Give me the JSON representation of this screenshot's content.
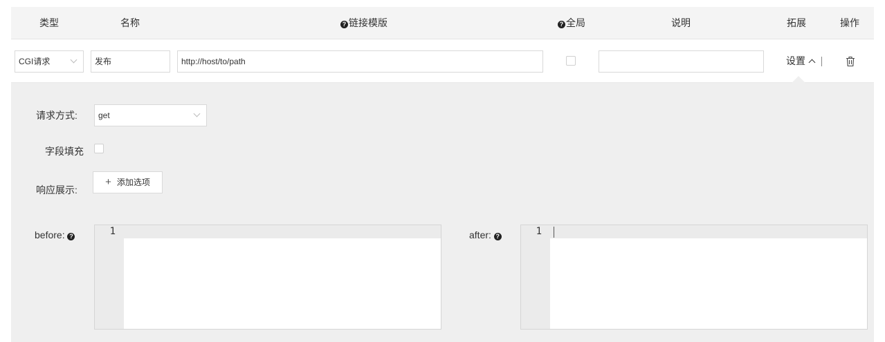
{
  "columns": {
    "type": "类型",
    "name": "名称",
    "link_template": "链接模版",
    "global": "全局",
    "description": "说明",
    "extension": "拓展",
    "actions": "操作"
  },
  "help_glyph": "?",
  "row": {
    "type_value": "CGI请求",
    "name_value": "发布",
    "link_value": "http://host/to/path",
    "global_checked": false,
    "description_value": "",
    "settings_label": "设置"
  },
  "panel": {
    "method_label": "请求方式:",
    "method_value": "get",
    "field_fill_label": "字段填充",
    "response_label": "响应展示:",
    "add_option_label": "添加选项",
    "before_label": "before:",
    "after_label": "after:",
    "before_line": "1",
    "after_line": "1"
  }
}
